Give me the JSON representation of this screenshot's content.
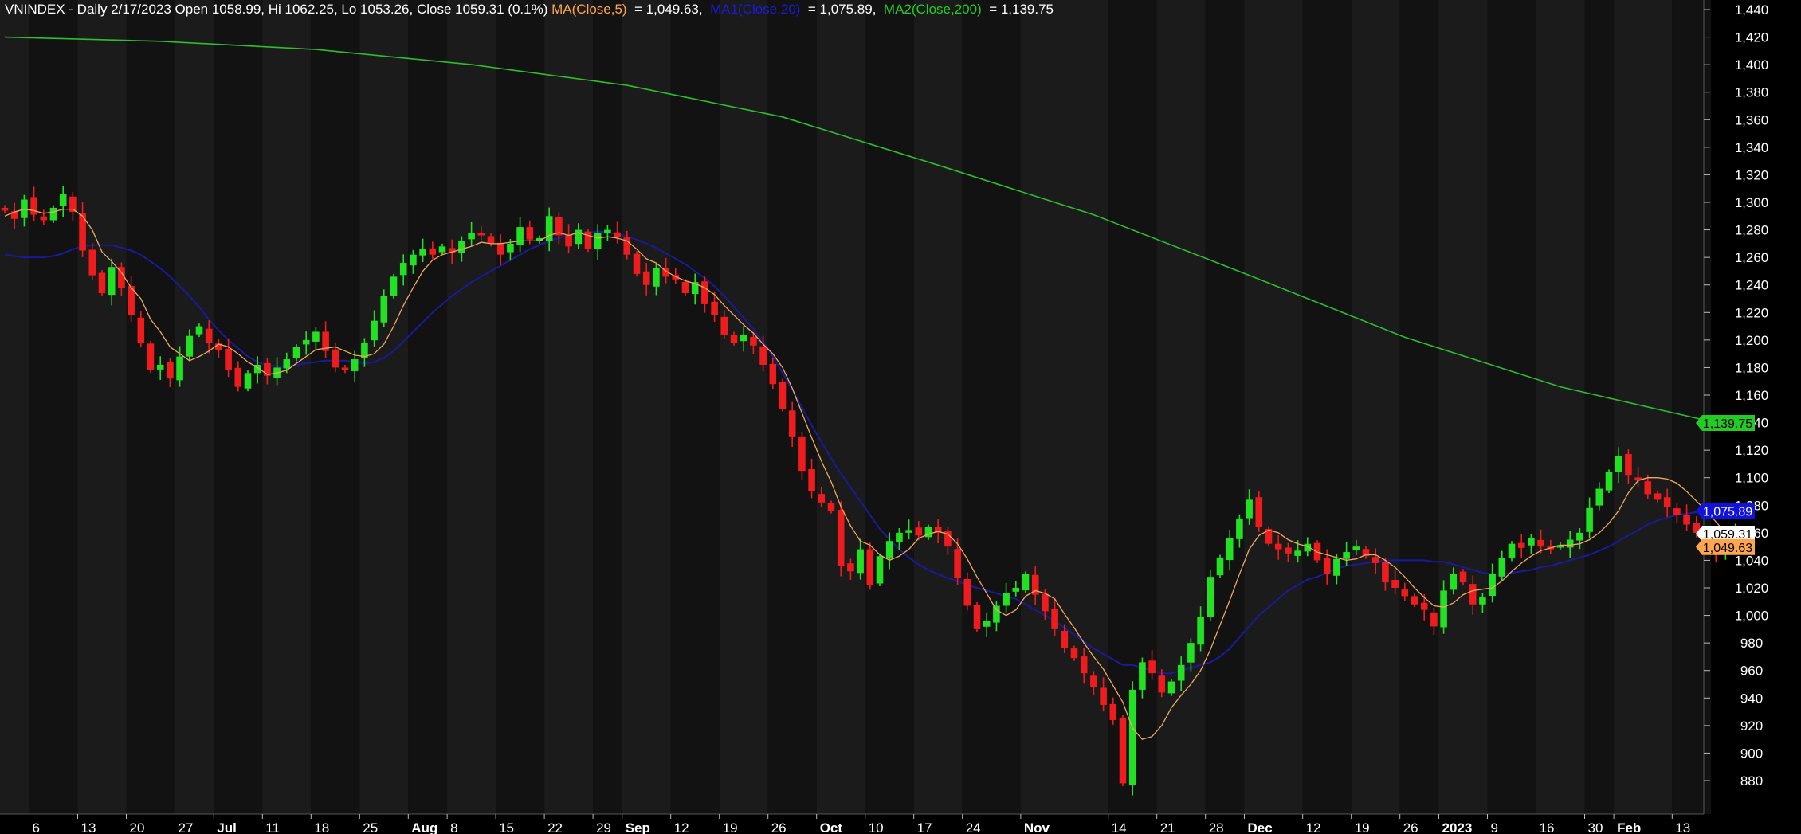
{
  "header": {
    "symbol_info": "VNINDEX - Daily 2/17/2023 Open 1058.99, Hi 1062.25, Lo 1053.26, Close 1059.31 (0.1%)",
    "ma5_label": "MA(Close,5)",
    "ma5_value": " = 1,049.63, ",
    "ma20_label": "MA1(Close,20)",
    "ma20_value": " = 1,075.89, ",
    "ma200_label": "MA2(Close,200)",
    "ma200_value": " = 1,139.75"
  },
  "colors": {
    "background": "#000000",
    "band_light": "#1b1b1b",
    "band_dark": "#121212",
    "up": "#22e022",
    "down": "#ee1c1c",
    "ma5": "#f0a860",
    "ma20": "#1a1a9a",
    "ma200": "#2dbd2d",
    "tag_ma200": "#22cc22",
    "tag_ma20": "#1212dd",
    "tag_close": "#ffffff",
    "tag_ma5": "#ffa54d"
  },
  "chart_data": {
    "type": "candlestick",
    "title": "VNINDEX - Daily 2/17/2023",
    "ylim": [
      870,
      1445
    ],
    "y_ticks": [
      880,
      900,
      920,
      940,
      960,
      980,
      1000,
      1020,
      1040,
      1060,
      1080,
      1100,
      1120,
      1140,
      1160,
      1180,
      1200,
      1220,
      1240,
      1260,
      1280,
      1300,
      1320,
      1340,
      1360,
      1380,
      1400,
      1420,
      1440
    ],
    "y_tick_labels": [
      "880",
      "900",
      "920",
      "940",
      "960",
      "980",
      "1,000",
      "1,020",
      "1,040",
      "1,060",
      "1,080",
      "1,100",
      "1,120",
      "1,140",
      "1,160",
      "1,180",
      "1,200",
      "1,220",
      "1,240",
      "1,260",
      "1,280",
      "1,300",
      "1,320",
      "1,340",
      "1,360",
      "1,380",
      "1,400",
      "1,420",
      "1,440"
    ],
    "x_labels": [
      {
        "label": "6",
        "index": 3,
        "bold": false
      },
      {
        "label": "13",
        "index": 8,
        "bold": false
      },
      {
        "label": "20",
        "index": 13,
        "bold": false
      },
      {
        "label": "27",
        "index": 18,
        "bold": false
      },
      {
        "label": "Jul",
        "index": 22,
        "bold": true
      },
      {
        "label": "11",
        "index": 27,
        "bold": false
      },
      {
        "label": "18",
        "index": 32,
        "bold": false
      },
      {
        "label": "25",
        "index": 37,
        "bold": false
      },
      {
        "label": "Aug",
        "index": 42,
        "bold": true
      },
      {
        "label": "8",
        "index": 46,
        "bold": false
      },
      {
        "label": "15",
        "index": 51,
        "bold": false
      },
      {
        "label": "22",
        "index": 56,
        "bold": false
      },
      {
        "label": "29",
        "index": 61,
        "bold": false
      },
      {
        "label": "Sep",
        "index": 64,
        "bold": true
      },
      {
        "label": "12",
        "index": 69,
        "bold": false
      },
      {
        "label": "19",
        "index": 74,
        "bold": false
      },
      {
        "label": "26",
        "index": 79,
        "bold": false
      },
      {
        "label": "Oct",
        "index": 84,
        "bold": true
      },
      {
        "label": "10",
        "index": 89,
        "bold": false
      },
      {
        "label": "17",
        "index": 94,
        "bold": false
      },
      {
        "label": "24",
        "index": 99,
        "bold": false
      },
      {
        "label": "Nov",
        "index": 105,
        "bold": true
      },
      {
        "label": "14",
        "index": 114,
        "bold": false
      },
      {
        "label": "21",
        "index": 119,
        "bold": false
      },
      {
        "label": "28",
        "index": 124,
        "bold": false
      },
      {
        "label": "Dec",
        "index": 128,
        "bold": true
      },
      {
        "label": "12",
        "index": 134,
        "bold": false
      },
      {
        "label": "19",
        "index": 139,
        "bold": false
      },
      {
        "label": "26",
        "index": 144,
        "bold": false
      },
      {
        "label": "2023",
        "index": 148,
        "bold": true
      },
      {
        "label": "9",
        "index": 153,
        "bold": false
      },
      {
        "label": "16",
        "index": 158,
        "bold": false
      },
      {
        "label": "30",
        "index": 163,
        "bold": false
      },
      {
        "label": "Feb",
        "index": 166,
        "bold": true
      },
      {
        "label": "13",
        "index": 172,
        "bold": false
      }
    ],
    "band_boundaries": [
      0,
      3,
      8,
      13,
      18,
      22,
      27,
      32,
      37,
      42,
      46,
      51,
      56,
      61,
      64,
      69,
      74,
      79,
      84,
      89,
      94,
      99,
      105,
      114,
      119,
      124,
      128,
      134,
      139,
      144,
      148,
      153,
      158,
      163,
      166,
      172,
      176
    ],
    "closes": [
      1294,
      1288,
      1302,
      1291,
      1287,
      1296,
      1306,
      1293,
      1265,
      1247,
      1234,
      1253,
      1238,
      1218,
      1198,
      1178,
      1182,
      1172,
      1188,
      1203,
      1210,
      1198,
      1193,
      1178,
      1166,
      1176,
      1182,
      1174,
      1180,
      1186,
      1195,
      1200,
      1206,
      1192,
      1180,
      1178,
      1186,
      1198,
      1214,
      1232,
      1246,
      1256,
      1262,
      1266,
      1262,
      1268,
      1263,
      1272,
      1278,
      1276,
      1270,
      1262,
      1270,
      1282,
      1273,
      1274,
      1290,
      1276,
      1268,
      1280,
      1266,
      1278,
      1280,
      1275,
      1262,
      1248,
      1240,
      1252,
      1246,
      1244,
      1234,
      1242,
      1226,
      1218,
      1204,
      1198,
      1204,
      1196,
      1182,
      1168,
      1150,
      1130,
      1105,
      1090,
      1082,
      1076,
      1036,
      1032,
      1048,
      1022,
      1043,
      1054,
      1060,
      1062,
      1058,
      1064,
      1060,
      1050,
      1027,
      1007,
      990,
      996,
      1007,
      1016,
      1020,
      1030,
      1015,
      1003,
      990,
      976,
      969,
      958,
      948,
      935,
      924,
      878,
      946,
      966,
      958,
      944,
      952,
      964,
      980,
      999,
      1028,
      1042,
      1056,
      1070,
      1084,
      1064,
      1052,
      1048,
      1045,
      1047,
      1052,
      1040,
      1030,
      1041,
      1046,
      1050,
      1043,
      1038,
      1024,
      1020,
      1014,
      1008,
      1004,
      992,
      1018,
      1030,
      1024,
      1008,
      1013,
      1030,
      1042,
      1052,
      1049,
      1056,
      1050,
      1048,
      1051,
      1055,
      1060,
      1078,
      1092,
      1104,
      1116,
      1102,
      1098,
      1088,
      1084,
      1079,
      1073,
      1066,
      1060,
      1048,
      1046,
      1056,
      1059
    ],
    "ma5": [
      1290,
      1293,
      1295,
      1294,
      1292,
      1293,
      1295,
      1295,
      1290,
      1280,
      1264,
      1257,
      1249,
      1238,
      1230,
      1215,
      1206,
      1195,
      1190,
      1185,
      1188,
      1192,
      1197,
      1195,
      1190,
      1184,
      1180,
      1175,
      1176,
      1178,
      1183,
      1188,
      1193,
      1194,
      1195,
      1192,
      1189,
      1188,
      1190,
      1197,
      1210,
      1225,
      1238,
      1250,
      1258,
      1262,
      1264,
      1266,
      1268,
      1271,
      1270,
      1270,
      1271,
      1272,
      1272,
      1272,
      1276,
      1278,
      1276,
      1278,
      1276,
      1274,
      1275,
      1274,
      1272,
      1266,
      1259,
      1256,
      1250,
      1246,
      1243,
      1241,
      1238,
      1233,
      1225,
      1218,
      1211,
      1205,
      1197,
      1190,
      1180,
      1165,
      1147,
      1129,
      1112,
      1097,
      1079,
      1065,
      1054,
      1051,
      1044,
      1040,
      1043,
      1048,
      1056,
      1059,
      1061,
      1059,
      1052,
      1041,
      1028,
      1016,
      1004,
      1000,
      1004,
      1014,
      1018,
      1016,
      1012,
      1001,
      991,
      980,
      970,
      961,
      949,
      937,
      918,
      910,
      912,
      920,
      933,
      942,
      950,
      960,
      975,
      993,
      1011,
      1030,
      1048,
      1058,
      1062,
      1060,
      1055,
      1052,
      1050,
      1046,
      1044,
      1042,
      1040,
      1041,
      1044,
      1044,
      1040,
      1035,
      1028,
      1020,
      1013,
      1007,
      1006,
      1009,
      1015,
      1018,
      1019,
      1020,
      1025,
      1032,
      1038,
      1043,
      1047,
      1049,
      1051,
      1051,
      1052,
      1055,
      1060,
      1067,
      1076,
      1089,
      1098,
      1100,
      1100,
      1099,
      1096,
      1090,
      1083,
      1076,
      1068,
      1060,
      1054,
      1049,
      1050
    ],
    "ma20": [
      1262,
      1261,
      1260,
      1260,
      1260,
      1261,
      1263,
      1266,
      1268,
      1269,
      1269,
      1269,
      1267,
      1265,
      1262,
      1257,
      1252,
      1246,
      1239,
      1232,
      1224,
      1215,
      1207,
      1200,
      1194,
      1188,
      1184,
      1182,
      1181,
      1181,
      1182,
      1183,
      1184,
      1185,
      1185,
      1185,
      1184,
      1183,
      1184,
      1187,
      1192,
      1199,
      1206,
      1213,
      1220,
      1226,
      1232,
      1237,
      1242,
      1246,
      1250,
      1254,
      1258,
      1262,
      1266,
      1269,
      1272,
      1274,
      1276,
      1278,
      1278,
      1279,
      1278,
      1277,
      1275,
      1273,
      1270,
      1267,
      1263,
      1259,
      1255,
      1250,
      1245,
      1239,
      1232,
      1224,
      1216,
      1208,
      1199,
      1188,
      1176,
      1164,
      1151,
      1138,
      1126,
      1114,
      1103,
      1093,
      1083,
      1073,
      1063,
      1055,
      1048,
      1042,
      1037,
      1033,
      1030,
      1027,
      1025,
      1022,
      1020,
      1018,
      1016,
      1014,
      1012,
      1008,
      1004,
      1000,
      996,
      991,
      986,
      981,
      976,
      972,
      968,
      964,
      964,
      962,
      960,
      958,
      958,
      960,
      962,
      964,
      966,
      970,
      976,
      984,
      992,
      1000,
      1006,
      1012,
      1018,
      1022,
      1026,
      1028,
      1031,
      1034,
      1036,
      1037,
      1038,
      1039,
      1040,
      1040,
      1040,
      1040,
      1040,
      1039,
      1039,
      1037,
      1035,
      1033,
      1031,
      1030,
      1030,
      1031,
      1032,
      1033,
      1035,
      1036,
      1038,
      1040,
      1042,
      1044,
      1047,
      1050,
      1054,
      1058,
      1062,
      1066,
      1069,
      1071,
      1073,
      1074,
      1075,
      1075,
      1076,
      1076,
      1076
    ],
    "ma200_points": [
      [
        0,
        1420
      ],
      [
        16,
        1417
      ],
      [
        32,
        1411
      ],
      [
        48,
        1400
      ],
      [
        64,
        1385
      ],
      [
        80,
        1362
      ],
      [
        96,
        1327
      ],
      [
        112,
        1291
      ],
      [
        128,
        1247
      ],
      [
        144,
        1202
      ],
      [
        160,
        1166
      ],
      [
        176,
        1140
      ]
    ],
    "last_values": {
      "ma200": "1,139.75",
      "ma20": "1,075.89",
      "close": "1,059.31",
      "ma5": "1,049.63"
    }
  }
}
